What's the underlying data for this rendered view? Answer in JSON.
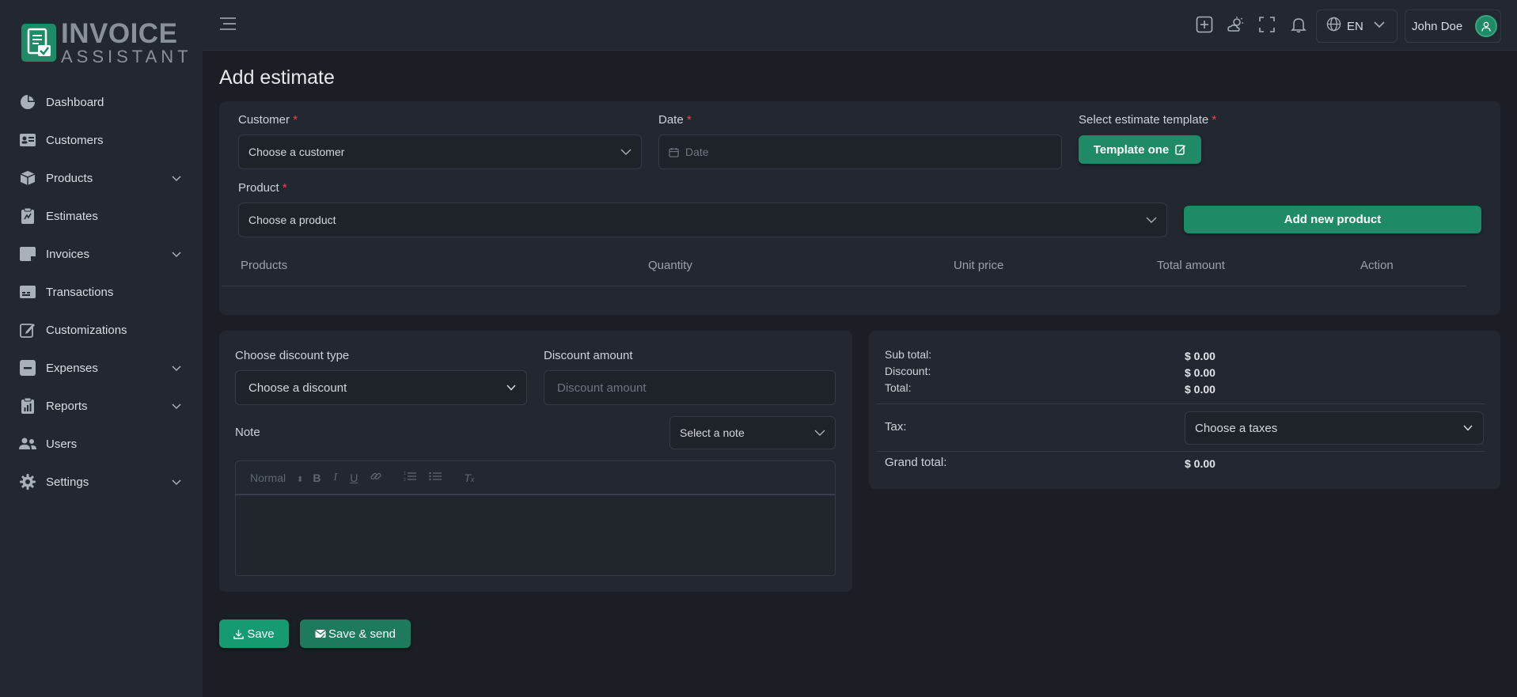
{
  "app": {
    "logo_line1": "INVOICE",
    "logo_line2": "ASSISTANT",
    "brand_color": "#1f8a66"
  },
  "sidebar": {
    "items": [
      {
        "label": "Dashboard",
        "icon": "pie-chart-icon",
        "has_submenu": false
      },
      {
        "label": "Customers",
        "icon": "id-card-icon",
        "has_submenu": false
      },
      {
        "label": "Products",
        "icon": "box-icon",
        "has_submenu": true
      },
      {
        "label": "Estimates",
        "icon": "clipboard-icon",
        "has_submenu": false
      },
      {
        "label": "Invoices",
        "icon": "invoice-icon",
        "has_submenu": true
      },
      {
        "label": "Transactions",
        "icon": "card-icon",
        "has_submenu": false
      },
      {
        "label": "Customizations",
        "icon": "edit-icon",
        "has_submenu": false
      },
      {
        "label": "Expenses",
        "icon": "minus-square-icon",
        "has_submenu": true
      },
      {
        "label": "Reports",
        "icon": "report-icon",
        "has_submenu": true
      },
      {
        "label": "Users",
        "icon": "users-icon",
        "has_submenu": false
      },
      {
        "label": "Settings",
        "icon": "gear-icon",
        "has_submenu": true
      }
    ]
  },
  "topbar": {
    "language": "EN",
    "user_name": "John Doe"
  },
  "page": {
    "title": "Add estimate"
  },
  "form": {
    "customer_label": "Customer",
    "customer_placeholder": "Choose a customer",
    "date_label": "Date",
    "date_placeholder": "Date",
    "template_label": "Select estimate template",
    "template_button": "Template one",
    "product_label": "Product",
    "product_placeholder": "Choose a product",
    "add_product_button": "Add new product",
    "required_mark": "*"
  },
  "table": {
    "columns": [
      "Products",
      "Quantity",
      "Unit price",
      "Total amount",
      "Action"
    ]
  },
  "discount": {
    "type_label": "Choose discount type",
    "type_placeholder": "Choose a discount",
    "amount_label": "Discount amount",
    "amount_placeholder": "Discount amount",
    "note_label": "Note",
    "note_select": "Select a note",
    "editor_format": "Normal"
  },
  "summary": {
    "subtotal_label": "Sub total:",
    "subtotal_value": "$ 0.00",
    "discount_label": "Discount:",
    "discount_value": "$ 0.00",
    "total_label": "Total:",
    "total_value": "$ 0.00",
    "tax_label": "Tax:",
    "tax_placeholder": "Choose a taxes",
    "grand_total_label": "Grand total:",
    "grand_total_value": "$ 0.00"
  },
  "actions": {
    "save": "Save",
    "save_send": "Save & send"
  }
}
